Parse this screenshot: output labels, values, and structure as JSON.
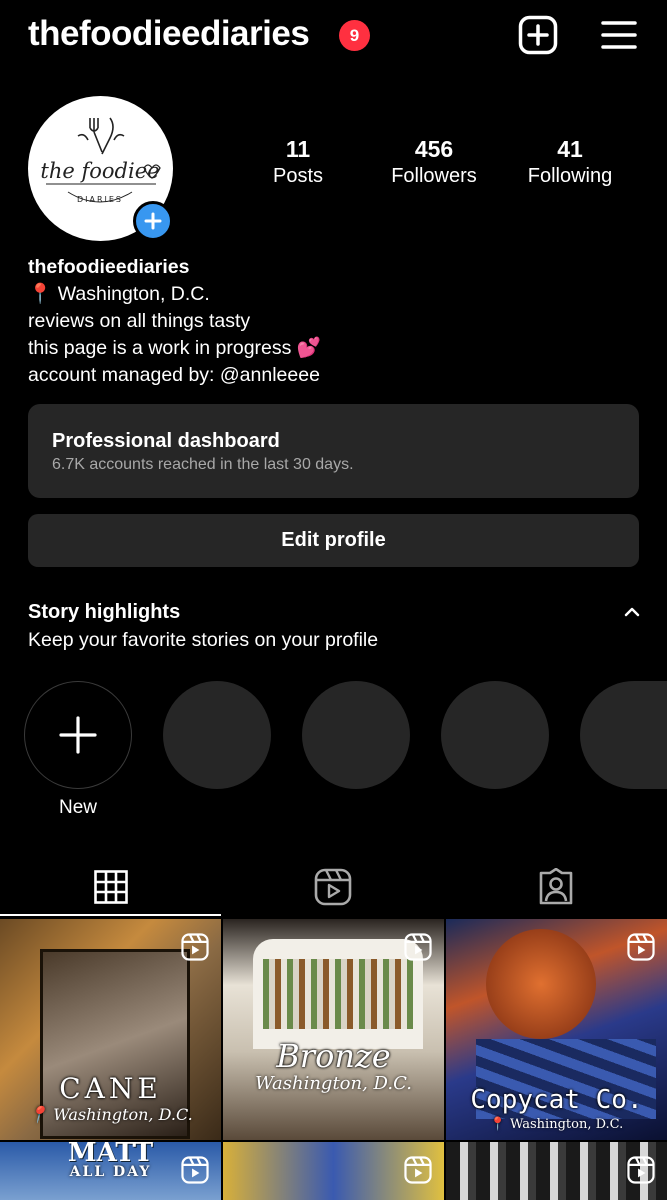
{
  "header": {
    "username": "thefoodieediaries",
    "notification_count": "9",
    "icons": [
      "add-post-icon",
      "hamburger-menu-icon"
    ]
  },
  "profile": {
    "avatar_text_main": "the foodiee",
    "avatar_text_sub": "DIARIES",
    "stats": {
      "posts_count": "11",
      "posts_label": "Posts",
      "followers_count": "456",
      "followers_label": "Followers",
      "following_count": "41",
      "following_label": "Following"
    },
    "bio": {
      "name": "thefoodieediaries",
      "location": "📍 Washington, D.C.",
      "line1": "reviews on all things tasty",
      "line2": "this page is a work in progress 💕",
      "line3": "account managed by: @annleeee"
    }
  },
  "dashboard": {
    "title": "Professional dashboard",
    "subtitle": "6.7K accounts reached in the last 30 days."
  },
  "edit_profile_label": "Edit profile",
  "highlights": {
    "title": "Story highlights",
    "subtitle": "Keep your favorite stories on your profile",
    "new_label": "New"
  },
  "tabs": [
    "grid-tab",
    "reels-tab",
    "tagged-tab"
  ],
  "grid": [
    {
      "caption": "CANE",
      "location": "📍 Washington, D.C."
    },
    {
      "caption": "Bronze",
      "location": "Washington, D.C."
    },
    {
      "caption": "Copycat Co.",
      "location": "📍 Washington, D.C."
    },
    {
      "caption": "MATT",
      "location": "ALL DAY"
    }
  ],
  "colors": {
    "background": "#000000",
    "surface": "#262626",
    "badge": "#ff3040",
    "accent_blue": "#3897f0"
  }
}
